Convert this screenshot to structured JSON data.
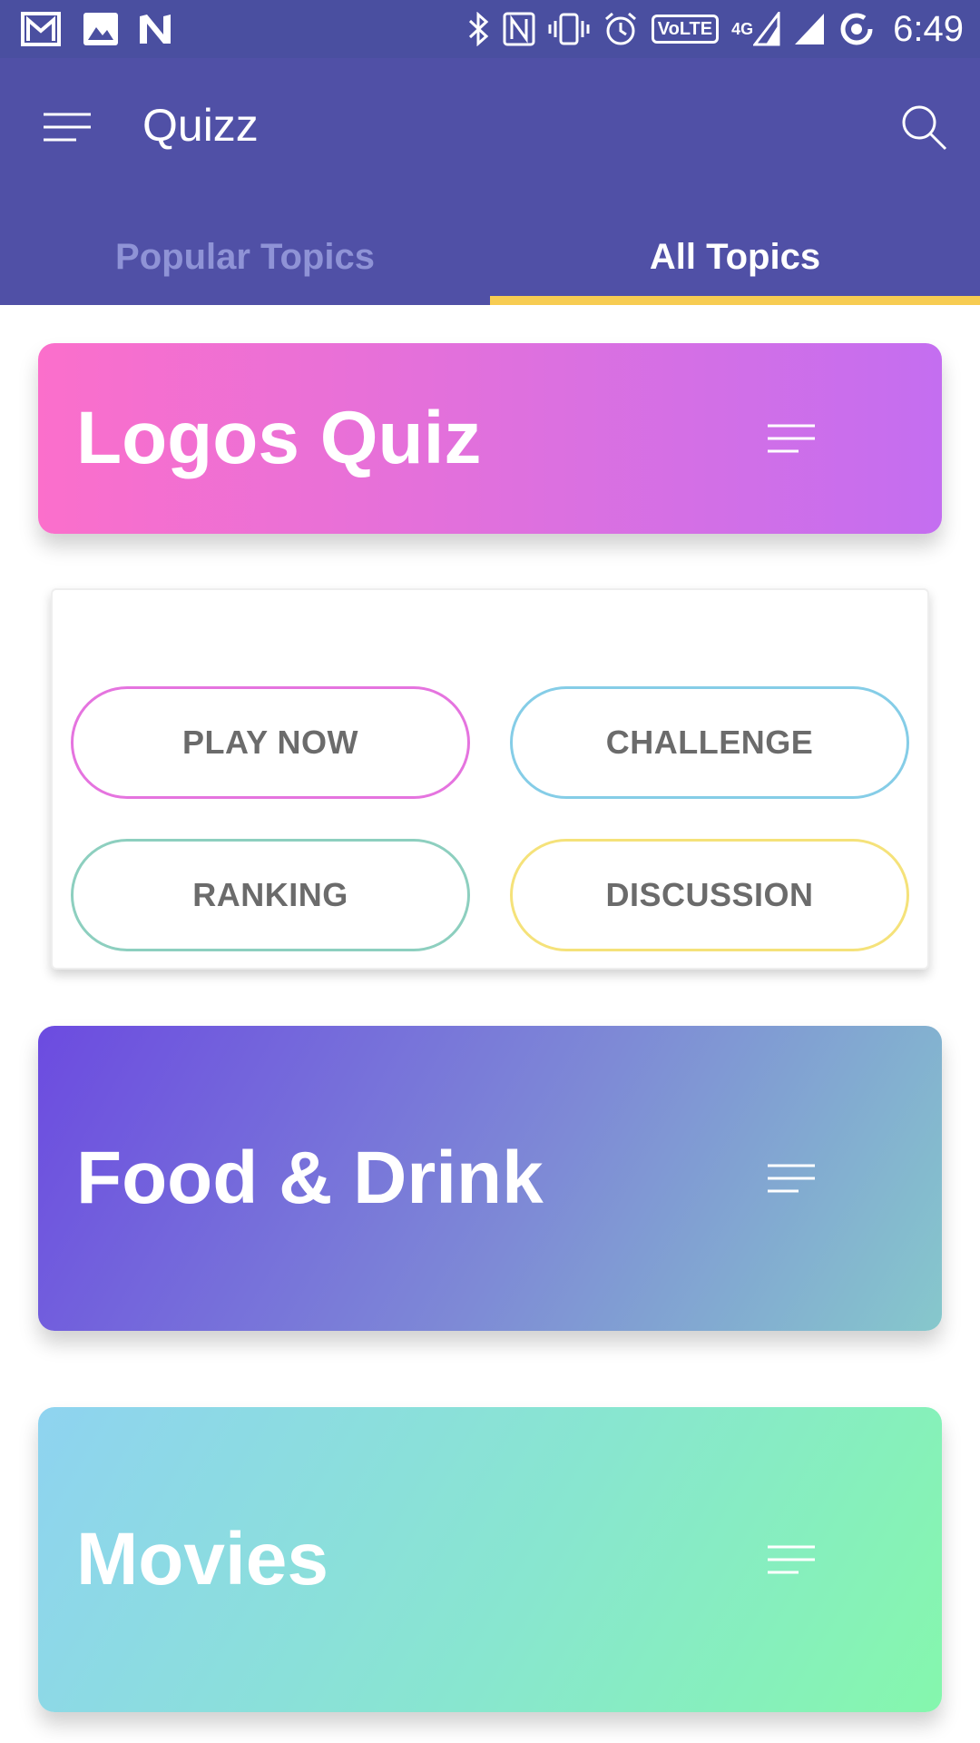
{
  "status_bar": {
    "time": "6:49",
    "left_icons": [
      "gmail-icon",
      "gallery-icon",
      "n-notification-icon"
    ],
    "right_icons": [
      "bluetooth-icon",
      "nfc-icon",
      "vibrate-icon",
      "alarm-icon",
      "volte-icon",
      "signal-4g-icon",
      "signal-icon",
      "sync-icon"
    ],
    "volte_label": "VoLTE",
    "network_label": "4G"
  },
  "app_bar": {
    "title": "Quizz",
    "color": "#5050a6"
  },
  "tabs": [
    {
      "label": "Popular Topics",
      "active": false
    },
    {
      "label": "All Topics",
      "active": true
    }
  ],
  "topics": [
    {
      "title": "Logos Quiz"
    },
    {
      "title": "Food & Drink"
    },
    {
      "title": "Movies"
    }
  ],
  "actions": {
    "play": "PLAY NOW",
    "challenge": "CHALLENGE",
    "ranking": "RANKING",
    "discussion": "DISCUSSION"
  },
  "colors": {
    "accent": "#f7cc52",
    "play": "#e574df",
    "challenge": "#85cde7",
    "ranking": "#8dcfbf",
    "discussion": "#f5e27a"
  }
}
